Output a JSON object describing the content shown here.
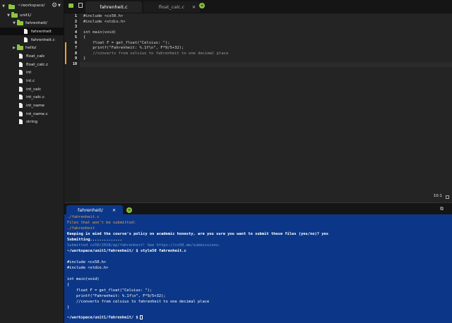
{
  "sidebar": {
    "root": "~/workspace/",
    "items": [
      {
        "label": "unit1/",
        "type": "folder"
      },
      {
        "label": "fahrenheit/",
        "type": "folder"
      },
      {
        "label": "fahrenheit",
        "type": "file"
      },
      {
        "label": "fahrenheit.c",
        "type": "file"
      },
      {
        "label": "hello/",
        "type": "folder"
      },
      {
        "label": "float_calc",
        "type": "file"
      },
      {
        "label": "float_calc.c",
        "type": "file"
      },
      {
        "label": "int",
        "type": "file"
      },
      {
        "label": "int.c",
        "type": "file"
      },
      {
        "label": "int_calc",
        "type": "file"
      },
      {
        "label": "int_calc.c",
        "type": "file"
      },
      {
        "label": "int_name",
        "type": "file"
      },
      {
        "label": "int_name.c",
        "type": "file"
      },
      {
        "label": "string",
        "type": "file"
      }
    ]
  },
  "tabs": [
    {
      "label": "fahrenheit.c",
      "active": true
    },
    {
      "label": "float_calc.c",
      "active": false
    }
  ],
  "editor": {
    "line_numbers": [
      "1",
      "2",
      "3",
      "4",
      "5",
      "6",
      "7",
      "8",
      "9",
      "10"
    ],
    "lines": [
      "#include <cs50.h>",
      "#include <stdio.h>",
      "",
      "int main(void)",
      "{",
      "    float F = get_float(\"Celsius: \");",
      "    printf(\"Fahrenheit: %.1f\\n\", F*9/5+32);",
      "    //converts from celsius to fahrenheit to one decimal place",
      "}",
      ""
    ],
    "cursor_position": "10:1"
  },
  "terminal": {
    "tab_label": "fahrenheit/",
    "lines": [
      "./fahrenheit.c",
      "Files that won't be submitted:",
      "./fahrenheit",
      "Keeping in mind the course's policy on academic honesty, are you sure you want to submit these files (yes/no)? yes",
      "Submitting..............",
      "Submitted cs50/2018/ap/fahrenheit! See https://cs50.me/submissions.",
      "~/workspace/unit1/fahrenheit/ $ style50 fahrenheit.c",
      "",
      "#include <cs50.h>",
      "#include <stdio.h>",
      "",
      "int main(void)",
      "{",
      "    float F = get_float(\"Celsius: \");",
      "    printf(\"Fahrenheit: %.1f\\n\", F*9/5+32);",
      "    //converts from celsius to fahrenheit to one decimal place",
      "}",
      "",
      "~/workspace/unit1/fahrenheit/ $"
    ]
  },
  "colors": {
    "accent": "#8cc63f",
    "terminal_bg": "#0c3788",
    "modified_marker": "#f0a030"
  }
}
